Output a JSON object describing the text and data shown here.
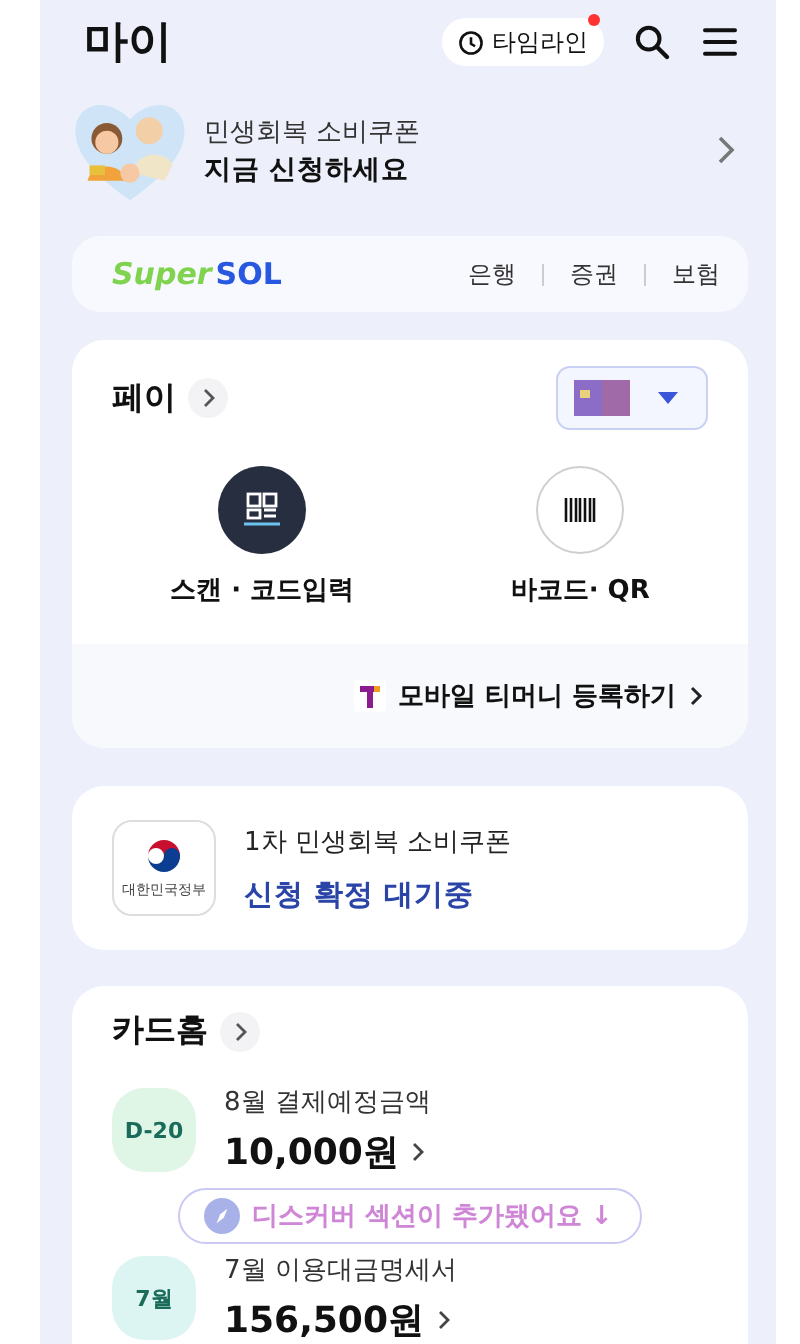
{
  "header": {
    "title": "마이",
    "timeline": {
      "label": "타임라인",
      "has_new": true
    }
  },
  "banner": {
    "line1": "민생회복 소비쿠폰",
    "line2": "지금 신청하세요"
  },
  "super_sol": {
    "logo_super": "Super",
    "logo_sol": "SOL",
    "links": [
      "은행",
      "증권",
      "보험"
    ]
  },
  "pay": {
    "title": "페이",
    "actions": [
      {
        "kind": "scan",
        "label": "스캔 · 코드입력"
      },
      {
        "kind": "barcode",
        "label": "바코드· QR"
      }
    ],
    "tmoney": "모바일 티머니 등록하기"
  },
  "coupon": {
    "title": "1차 민생회복 소비쿠폰",
    "status": "신청 확정 대기중",
    "emblem_text": "대한민국정부"
  },
  "card_home": {
    "title": "카드홈",
    "items": [
      {
        "badge": "D-20",
        "color": "#dff5e6",
        "label": "8월 결제예정금액",
        "amount": "10,000원"
      },
      {
        "badge": "7월",
        "color": "#dcf5f3",
        "label": "7월 이용대금명세서",
        "amount": "156,500원"
      }
    ]
  },
  "toast": {
    "text": "디스커버 섹션이 추가됐어요 ↓"
  }
}
